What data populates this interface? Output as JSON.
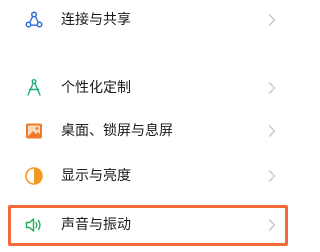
{
  "settings": {
    "items": [
      {
        "label": "连接与共享",
        "icon": "connection-share-icon",
        "icon_color": "#2f6fd6"
      },
      {
        "label": "个性化定制",
        "icon": "personalization-icon",
        "icon_color": "#22b07a"
      },
      {
        "label": "桌面、锁屏与息屏",
        "icon": "wallpaper-icon",
        "icon_color": "#f07a2a"
      },
      {
        "label": "显示与亮度",
        "icon": "brightness-icon",
        "icon_color": "#f29a1e"
      },
      {
        "label": "声音与振动",
        "icon": "sound-vibration-icon",
        "icon_color": "#1fab5d"
      }
    ],
    "highlight_color": "#f26b36"
  }
}
